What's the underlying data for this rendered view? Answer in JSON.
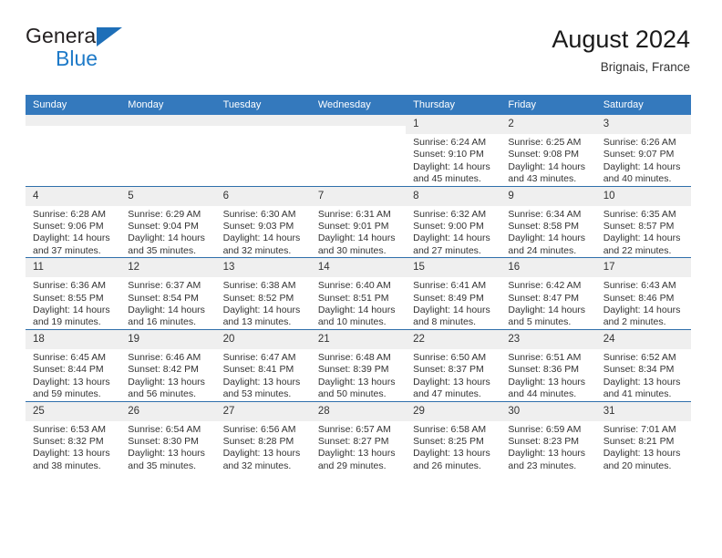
{
  "brand": {
    "name_part1": "General",
    "name_part2": "Blue",
    "logo_icon": "blue-triangle-icon"
  },
  "header": {
    "title": "August 2024",
    "subtitle": "Brignais, France"
  },
  "colors": {
    "header_blue": "#3479bd",
    "row_divider_blue": "#2f6fab",
    "daynum_band": "#efefef",
    "brand_blue": "#1e7ac8"
  },
  "calendar": {
    "weekday_headers": [
      "Sunday",
      "Monday",
      "Tuesday",
      "Wednesday",
      "Thursday",
      "Friday",
      "Saturday"
    ],
    "weeks": [
      [
        {
          "day": "",
          "empty": true,
          "sunrise": "",
          "sunset": "",
          "daylight_line1": "",
          "daylight_line2": ""
        },
        {
          "day": "",
          "empty": true,
          "sunrise": "",
          "sunset": "",
          "daylight_line1": "",
          "daylight_line2": ""
        },
        {
          "day": "",
          "empty": true,
          "sunrise": "",
          "sunset": "",
          "daylight_line1": "",
          "daylight_line2": ""
        },
        {
          "day": "",
          "empty": true,
          "sunrise": "",
          "sunset": "",
          "daylight_line1": "",
          "daylight_line2": ""
        },
        {
          "day": "1",
          "sunrise": "Sunrise: 6:24 AM",
          "sunset": "Sunset: 9:10 PM",
          "daylight_line1": "Daylight: 14 hours",
          "daylight_line2": "and 45 minutes."
        },
        {
          "day": "2",
          "sunrise": "Sunrise: 6:25 AM",
          "sunset": "Sunset: 9:08 PM",
          "daylight_line1": "Daylight: 14 hours",
          "daylight_line2": "and 43 minutes."
        },
        {
          "day": "3",
          "sunrise": "Sunrise: 6:26 AM",
          "sunset": "Sunset: 9:07 PM",
          "daylight_line1": "Daylight: 14 hours",
          "daylight_line2": "and 40 minutes."
        }
      ],
      [
        {
          "day": "4",
          "sunrise": "Sunrise: 6:28 AM",
          "sunset": "Sunset: 9:06 PM",
          "daylight_line1": "Daylight: 14 hours",
          "daylight_line2": "and 37 minutes."
        },
        {
          "day": "5",
          "sunrise": "Sunrise: 6:29 AM",
          "sunset": "Sunset: 9:04 PM",
          "daylight_line1": "Daylight: 14 hours",
          "daylight_line2": "and 35 minutes."
        },
        {
          "day": "6",
          "sunrise": "Sunrise: 6:30 AM",
          "sunset": "Sunset: 9:03 PM",
          "daylight_line1": "Daylight: 14 hours",
          "daylight_line2": "and 32 minutes."
        },
        {
          "day": "7",
          "sunrise": "Sunrise: 6:31 AM",
          "sunset": "Sunset: 9:01 PM",
          "daylight_line1": "Daylight: 14 hours",
          "daylight_line2": "and 30 minutes."
        },
        {
          "day": "8",
          "sunrise": "Sunrise: 6:32 AM",
          "sunset": "Sunset: 9:00 PM",
          "daylight_line1": "Daylight: 14 hours",
          "daylight_line2": "and 27 minutes."
        },
        {
          "day": "9",
          "sunrise": "Sunrise: 6:34 AM",
          "sunset": "Sunset: 8:58 PM",
          "daylight_line1": "Daylight: 14 hours",
          "daylight_line2": "and 24 minutes."
        },
        {
          "day": "10",
          "sunrise": "Sunrise: 6:35 AM",
          "sunset": "Sunset: 8:57 PM",
          "daylight_line1": "Daylight: 14 hours",
          "daylight_line2": "and 22 minutes."
        }
      ],
      [
        {
          "day": "11",
          "sunrise": "Sunrise: 6:36 AM",
          "sunset": "Sunset: 8:55 PM",
          "daylight_line1": "Daylight: 14 hours",
          "daylight_line2": "and 19 minutes."
        },
        {
          "day": "12",
          "sunrise": "Sunrise: 6:37 AM",
          "sunset": "Sunset: 8:54 PM",
          "daylight_line1": "Daylight: 14 hours",
          "daylight_line2": "and 16 minutes."
        },
        {
          "day": "13",
          "sunrise": "Sunrise: 6:38 AM",
          "sunset": "Sunset: 8:52 PM",
          "daylight_line1": "Daylight: 14 hours",
          "daylight_line2": "and 13 minutes."
        },
        {
          "day": "14",
          "sunrise": "Sunrise: 6:40 AM",
          "sunset": "Sunset: 8:51 PM",
          "daylight_line1": "Daylight: 14 hours",
          "daylight_line2": "and 10 minutes."
        },
        {
          "day": "15",
          "sunrise": "Sunrise: 6:41 AM",
          "sunset": "Sunset: 8:49 PM",
          "daylight_line1": "Daylight: 14 hours",
          "daylight_line2": "and 8 minutes."
        },
        {
          "day": "16",
          "sunrise": "Sunrise: 6:42 AM",
          "sunset": "Sunset: 8:47 PM",
          "daylight_line1": "Daylight: 14 hours",
          "daylight_line2": "and 5 minutes."
        },
        {
          "day": "17",
          "sunrise": "Sunrise: 6:43 AM",
          "sunset": "Sunset: 8:46 PM",
          "daylight_line1": "Daylight: 14 hours",
          "daylight_line2": "and 2 minutes."
        }
      ],
      [
        {
          "day": "18",
          "sunrise": "Sunrise: 6:45 AM",
          "sunset": "Sunset: 8:44 PM",
          "daylight_line1": "Daylight: 13 hours",
          "daylight_line2": "and 59 minutes."
        },
        {
          "day": "19",
          "sunrise": "Sunrise: 6:46 AM",
          "sunset": "Sunset: 8:42 PM",
          "daylight_line1": "Daylight: 13 hours",
          "daylight_line2": "and 56 minutes."
        },
        {
          "day": "20",
          "sunrise": "Sunrise: 6:47 AM",
          "sunset": "Sunset: 8:41 PM",
          "daylight_line1": "Daylight: 13 hours",
          "daylight_line2": "and 53 minutes."
        },
        {
          "day": "21",
          "sunrise": "Sunrise: 6:48 AM",
          "sunset": "Sunset: 8:39 PM",
          "daylight_line1": "Daylight: 13 hours",
          "daylight_line2": "and 50 minutes."
        },
        {
          "day": "22",
          "sunrise": "Sunrise: 6:50 AM",
          "sunset": "Sunset: 8:37 PM",
          "daylight_line1": "Daylight: 13 hours",
          "daylight_line2": "and 47 minutes."
        },
        {
          "day": "23",
          "sunrise": "Sunrise: 6:51 AM",
          "sunset": "Sunset: 8:36 PM",
          "daylight_line1": "Daylight: 13 hours",
          "daylight_line2": "and 44 minutes."
        },
        {
          "day": "24",
          "sunrise": "Sunrise: 6:52 AM",
          "sunset": "Sunset: 8:34 PM",
          "daylight_line1": "Daylight: 13 hours",
          "daylight_line2": "and 41 minutes."
        }
      ],
      [
        {
          "day": "25",
          "sunrise": "Sunrise: 6:53 AM",
          "sunset": "Sunset: 8:32 PM",
          "daylight_line1": "Daylight: 13 hours",
          "daylight_line2": "and 38 minutes."
        },
        {
          "day": "26",
          "sunrise": "Sunrise: 6:54 AM",
          "sunset": "Sunset: 8:30 PM",
          "daylight_line1": "Daylight: 13 hours",
          "daylight_line2": "and 35 minutes."
        },
        {
          "day": "27",
          "sunrise": "Sunrise: 6:56 AM",
          "sunset": "Sunset: 8:28 PM",
          "daylight_line1": "Daylight: 13 hours",
          "daylight_line2": "and 32 minutes."
        },
        {
          "day": "28",
          "sunrise": "Sunrise: 6:57 AM",
          "sunset": "Sunset: 8:27 PM",
          "daylight_line1": "Daylight: 13 hours",
          "daylight_line2": "and 29 minutes."
        },
        {
          "day": "29",
          "sunrise": "Sunrise: 6:58 AM",
          "sunset": "Sunset: 8:25 PM",
          "daylight_line1": "Daylight: 13 hours",
          "daylight_line2": "and 26 minutes."
        },
        {
          "day": "30",
          "sunrise": "Sunrise: 6:59 AM",
          "sunset": "Sunset: 8:23 PM",
          "daylight_line1": "Daylight: 13 hours",
          "daylight_line2": "and 23 minutes."
        },
        {
          "day": "31",
          "sunrise": "Sunrise: 7:01 AM",
          "sunset": "Sunset: 8:21 PM",
          "daylight_line1": "Daylight: 13 hours",
          "daylight_line2": "and 20 minutes."
        }
      ]
    ]
  }
}
